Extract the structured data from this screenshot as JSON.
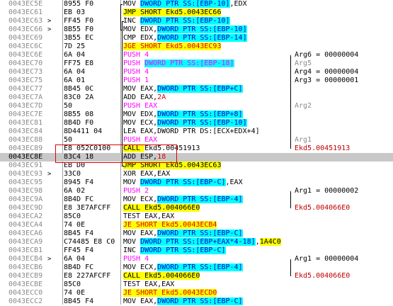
{
  "rows": [
    {
      "addr": "0043EC5E",
      "mark": "",
      "hex": "8955 F0",
      "dis": [
        {
          "t": "MOV ",
          "c": "c-black"
        },
        {
          "t": "DWORD PTR SS:[EBP-10]",
          "c": "hl-cyan c-blue"
        },
        {
          "t": ",EDX",
          "c": "c-black"
        }
      ],
      "cmt": []
    },
    {
      "addr": "0043EC61",
      "mark": "",
      "hex": "EB 03",
      "dis": [
        {
          "t": "JMP SHORT Ekd5.0043EC66",
          "c": "hl-yellow c-black"
        }
      ],
      "cmt": []
    },
    {
      "addr": "0043EC63",
      "mark": ">",
      "hex": "FF45 F0",
      "dis": [
        {
          "t": "INC ",
          "c": "c-black"
        },
        {
          "t": "DWORD PTR SS:[EBP-10]",
          "c": "hl-cyan c-blue"
        }
      ],
      "cmt": []
    },
    {
      "addr": "0043EC66",
      "mark": ">",
      "hex": "8B55 F0",
      "dis": [
        {
          "t": "MOV EDX,",
          "c": "c-black"
        },
        {
          "t": "DWORD PTR SS:[EBP-10]",
          "c": "hl-cyan c-blue"
        }
      ],
      "cmt": []
    },
    {
      "addr": "0043EC69",
      "mark": "",
      "hex": "3B55 EC",
      "dis": [
        {
          "t": "CMP EDX,",
          "c": "c-black"
        },
        {
          "t": "DWORD PTR SS:[EBP-14]",
          "c": "hl-cyan c-blue"
        }
      ],
      "cmt": []
    },
    {
      "addr": "0043EC6C",
      "mark": "",
      "hex": "7D 25",
      "dis": [
        {
          "t": "JGE SHORT Ekd5.0043EC93",
          "c": "hl-red-bg"
        }
      ],
      "cmt": []
    },
    {
      "addr": "0043EC6E",
      "mark": "",
      "hex": "6A 04",
      "dis": [
        {
          "t": "PUSH ",
          "c": "c-mag"
        },
        {
          "t": "4",
          "c": "c-mag"
        }
      ],
      "cmt": [
        {
          "t": "Arg6 = 00000004",
          "c": "c-black"
        }
      ]
    },
    {
      "addr": "0043EC70",
      "mark": "",
      "hex": "FF75 E8",
      "dis": [
        {
          "t": "PUSH ",
          "c": "c-mag"
        },
        {
          "t": "DWORD PTR SS:[EBP-18]",
          "c": "hl-mag-bg"
        }
      ],
      "cmt": [
        {
          "t": "Arg5",
          "c": "c-gray"
        }
      ]
    },
    {
      "addr": "0043EC73",
      "mark": "",
      "hex": "6A 04",
      "dis": [
        {
          "t": "PUSH ",
          "c": "c-mag"
        },
        {
          "t": "4",
          "c": "c-mag"
        }
      ],
      "cmt": [
        {
          "t": "Arg4 = 00000004",
          "c": "c-black"
        }
      ]
    },
    {
      "addr": "0043EC75",
      "mark": "",
      "hex": "6A 01",
      "dis": [
        {
          "t": "PUSH ",
          "c": "c-mag"
        },
        {
          "t": "1",
          "c": "c-mag"
        }
      ],
      "cmt": [
        {
          "t": "Arg3 = 00000001",
          "c": "c-black"
        }
      ]
    },
    {
      "addr": "0043EC77",
      "mark": "",
      "hex": "8B45 0C",
      "dis": [
        {
          "t": "MOV EAX,",
          "c": "c-black"
        },
        {
          "t": "DWORD PTR SS:[EBP+C]",
          "c": "hl-cyan c-blue"
        }
      ],
      "cmt": []
    },
    {
      "addr": "0043EC7A",
      "mark": "",
      "hex": "83C0 2A",
      "dis": [
        {
          "t": "ADD EAX,",
          "c": "c-black"
        },
        {
          "t": "2A",
          "c": "c-red"
        }
      ],
      "cmt": []
    },
    {
      "addr": "0043EC7D",
      "mark": "",
      "hex": "50",
      "dis": [
        {
          "t": "PUSH EAX",
          "c": "c-mag"
        }
      ],
      "cmt": [
        {
          "t": "Arg2",
          "c": "c-gray"
        }
      ]
    },
    {
      "addr": "0043EC7E",
      "mark": "",
      "hex": "8B55 08",
      "dis": [
        {
          "t": "MOV EDX,",
          "c": "c-black"
        },
        {
          "t": "DWORD PTR SS:[EBP+8]",
          "c": "hl-cyan c-blue"
        }
      ],
      "cmt": []
    },
    {
      "addr": "0043EC81",
      "mark": "",
      "hex": "8B4D F0",
      "dis": [
        {
          "t": "MOV ECX,",
          "c": "c-black"
        },
        {
          "t": "DWORD PTR SS:[EBP-10]",
          "c": "hl-cyan c-blue"
        }
      ],
      "cmt": []
    },
    {
      "addr": "0043EC84",
      "mark": "",
      "hex": "8D4411 04",
      "dis": [
        {
          "t": "LEA EAX,DWORD PTR DS:[ECX+EDX+4]",
          "c": "c-black"
        }
      ],
      "cmt": []
    },
    {
      "addr": "0043EC88",
      "mark": "",
      "hex": "50",
      "dis": [
        {
          "t": "PUSH EAX",
          "c": "c-mag"
        }
      ],
      "cmt": [
        {
          "t": "Arg1",
          "c": "c-gray"
        }
      ]
    },
    {
      "addr": "0043EC89",
      "mark": "",
      "hex": "E8 052C0100",
      "dis": [
        {
          "t": "CALL ",
          "c": "hl-yellow c-black"
        },
        {
          "t": "Ekd5.00451913",
          "c": "c-black"
        }
      ],
      "cmt": [
        {
          "t": "Ekd5.00451913",
          "c": "c-darkred"
        }
      ]
    },
    {
      "addr": "0043EC8E",
      "mark": "",
      "hex": "83C4 18",
      "dis": [
        {
          "t": "ADD ESP,",
          "c": "c-black"
        },
        {
          "t": "18",
          "c": "c-red"
        }
      ],
      "cmt": [],
      "sel": true
    },
    {
      "addr": "0043EC91",
      "mark": "",
      "hex": "EB D0",
      "dis": [
        {
          "t": "JMP SHORT Ekd5.0043EC63",
          "c": "hl-yellow c-black"
        }
      ],
      "cmt": []
    },
    {
      "addr": "0043EC93",
      "mark": ">",
      "hex": "33C0",
      "dis": [
        {
          "t": "XOR EAX,EAX",
          "c": "c-black"
        }
      ],
      "cmt": []
    },
    {
      "addr": "0043EC95",
      "mark": "",
      "hex": "8945 F4",
      "dis": [
        {
          "t": "MOV ",
          "c": "c-black"
        },
        {
          "t": "DWORD PTR SS:[EBP-C]",
          "c": "hl-cyan c-blue"
        },
        {
          "t": ",EAX",
          "c": "c-black"
        }
      ],
      "cmt": []
    },
    {
      "addr": "0043EC98",
      "mark": "",
      "hex": "6A 02",
      "dis": [
        {
          "t": "PUSH ",
          "c": "c-mag"
        },
        {
          "t": "2",
          "c": "c-mag"
        }
      ],
      "cmt": [
        {
          "t": "Arg1 = 00000002",
          "c": "c-black"
        }
      ]
    },
    {
      "addr": "0043EC9A",
      "mark": "",
      "hex": "8B4D FC",
      "dis": [
        {
          "t": "MOV ECX,",
          "c": "c-black"
        },
        {
          "t": "DWORD PTR SS:[EBP-4]",
          "c": "hl-cyan c-blue"
        }
      ],
      "cmt": []
    },
    {
      "addr": "0043EC9D",
      "mark": "",
      "hex": "E8 3E7AFCFF",
      "dis": [
        {
          "t": "CALL",
          "c": "hl-yellow c-black"
        },
        {
          "t": " Ekd5.004066E0",
          "c": "hl-yellow c-black"
        }
      ],
      "cmt": [
        {
          "t": "Ekd5.004066E0",
          "c": "c-darkred"
        }
      ]
    },
    {
      "addr": "0043ECA2",
      "mark": "",
      "hex": "85C0",
      "dis": [
        {
          "t": "TEST EAX,EAX",
          "c": "c-black"
        }
      ],
      "cmt": []
    },
    {
      "addr": "0043ECA4",
      "mark": "",
      "hex": "74 0E",
      "dis": [
        {
          "t": "JE SHORT Ekd5.0043ECB4",
          "c": "hl-red-bg"
        }
      ],
      "cmt": []
    },
    {
      "addr": "0043ECA6",
      "mark": "",
      "hex": "8B45 F4",
      "dis": [
        {
          "t": "MOV EAX,",
          "c": "c-black"
        },
        {
          "t": "DWORD PTR SS:[EBP-C]",
          "c": "hl-cyan c-blue"
        }
      ],
      "cmt": []
    },
    {
      "addr": "0043ECA9",
      "mark": "",
      "hex": "C74485 E8 C0",
      "dis": [
        {
          "t": "MOV ",
          "c": "c-black"
        },
        {
          "t": "DWORD PTR SS:[EBP+EAX*4-18]",
          "c": "hl-cyan c-blue"
        },
        {
          "t": ",",
          "c": "c-black"
        },
        {
          "t": "1A4C0",
          "c": "hl-yellow c-black"
        }
      ],
      "cmt": []
    },
    {
      "addr": "0043ECB1",
      "mark": "",
      "hex": "FF45 F4",
      "dis": [
        {
          "t": "INC ",
          "c": "c-black"
        },
        {
          "t": "DWORD PTR SS:[EBP-C]",
          "c": "hl-cyan c-blue"
        }
      ],
      "cmt": []
    },
    {
      "addr": "0043ECB4",
      "mark": ">",
      "hex": "6A 04",
      "dis": [
        {
          "t": "PUSH ",
          "c": "c-mag"
        },
        {
          "t": "4",
          "c": "c-mag"
        }
      ],
      "cmt": [
        {
          "t": "Arg1 = 00000004",
          "c": "c-black"
        }
      ]
    },
    {
      "addr": "0043ECB6",
      "mark": "",
      "hex": "8B4D FC",
      "dis": [
        {
          "t": "MOV ECX,",
          "c": "c-black"
        },
        {
          "t": "DWORD PTR SS:[EBP-4]",
          "c": "hl-cyan c-blue"
        }
      ],
      "cmt": []
    },
    {
      "addr": "0043ECB9",
      "mark": "",
      "hex": "E8 227AFCFF",
      "dis": [
        {
          "t": "CALL",
          "c": "hl-yellow c-black"
        },
        {
          "t": " Ekd5.004066E0",
          "c": "hl-yellow c-black"
        }
      ],
      "cmt": [
        {
          "t": "Ekd5.004066E0",
          "c": "c-darkred"
        }
      ]
    },
    {
      "addr": "0043ECBE",
      "mark": "",
      "hex": "85C0",
      "dis": [
        {
          "t": "TEST EAX,EAX",
          "c": "c-black"
        }
      ],
      "cmt": []
    },
    {
      "addr": "0043ECC0",
      "mark": "",
      "hex": "74 0E",
      "dis": [
        {
          "t": "JE SHORT Ekd5.0043ECD0",
          "c": "hl-red-bg"
        }
      ],
      "cmt": []
    },
    {
      "addr": "0043ECC2",
      "mark": "",
      "hex": "8B45 F4",
      "dis": [
        {
          "t": "MOV EAX,",
          "c": "c-black"
        },
        {
          "t": "DWORD PTR SS:[EBP-C]",
          "c": "hl-cyan c-blue"
        }
      ],
      "cmt": []
    }
  ]
}
